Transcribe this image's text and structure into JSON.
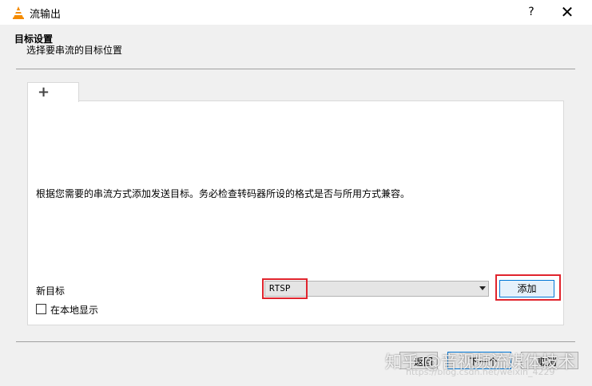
{
  "window": {
    "title": "流输出",
    "help_label": "?",
    "close_label": "✕",
    "icon": "vlc-cone-icon",
    "accent_color": "#0078d7",
    "highlight_color": "#e0242d"
  },
  "header": {
    "title": "目标设置",
    "subtitle": "选择要串流的目标位置"
  },
  "tabs": [
    {
      "label": "+",
      "icon": "plus-icon"
    }
  ],
  "content": {
    "description": "根据您需要的串流方式添加发送目标。务必检查转码器所设的格式是否与所用方式兼容。",
    "new_target_label": "新目标",
    "target_select": {
      "value": "RTSP"
    },
    "add_button_label": "添加",
    "local_display": {
      "label": "在本地显示",
      "checked": false
    }
  },
  "footer": {
    "back_label": "返回",
    "next_label": "下一个",
    "cancel_label": "取消"
  },
  "watermark": {
    "text": "知乎 @音视频流媒体技术",
    "subtext": "https://blog.csdn.net/weixin_4229"
  }
}
